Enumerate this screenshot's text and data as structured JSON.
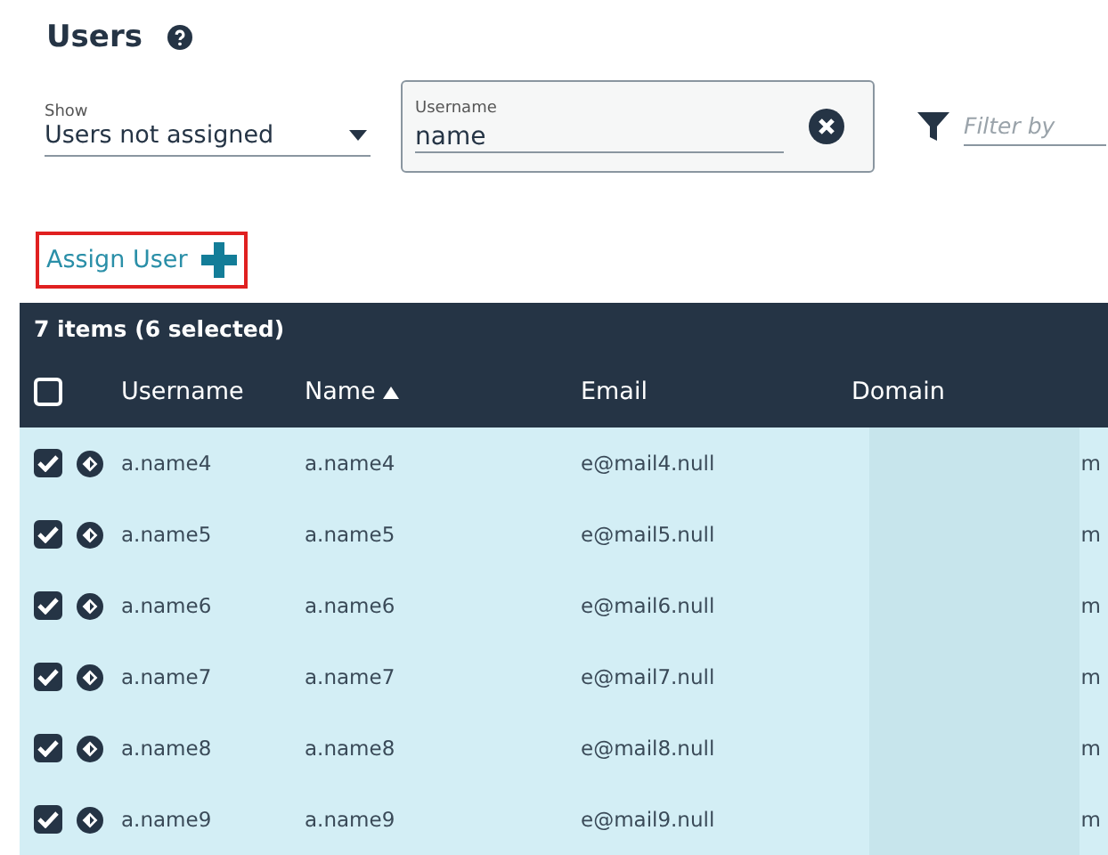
{
  "title": "Users",
  "show_filter": {
    "label": "Show",
    "value": "Users not assigned"
  },
  "username_field": {
    "label": "Username",
    "value": "name"
  },
  "filter_field": {
    "placeholder": "Filter by"
  },
  "assign_button": {
    "label": "Assign User"
  },
  "table": {
    "summary": "7 items (6 selected)",
    "select_all_checked": false,
    "columns": [
      {
        "label": "Username",
        "sorted": false
      },
      {
        "label": "Name",
        "sorted": true
      },
      {
        "label": "Email",
        "sorted": false
      },
      {
        "label": "Domain",
        "sorted": false
      }
    ],
    "rows": [
      {
        "username": "a.name4",
        "name": "a.name4",
        "email": "e@mail4.null",
        "domain": "m",
        "selected": true
      },
      {
        "username": "a.name5",
        "name": "a.name5",
        "email": "e@mail5.null",
        "domain": "m",
        "selected": true
      },
      {
        "username": "a.name6",
        "name": "a.name6",
        "email": "e@mail6.null",
        "domain": "m",
        "selected": true
      },
      {
        "username": "a.name7",
        "name": "a.name7",
        "email": "e@mail7.null",
        "domain": "m",
        "selected": true
      },
      {
        "username": "a.name8",
        "name": "a.name8",
        "email": "e@mail8.null",
        "domain": "m",
        "selected": true
      },
      {
        "username": "a.name9",
        "name": "a.name9",
        "email": "e@mail9.null",
        "domain": "m",
        "selected": true
      }
    ]
  }
}
